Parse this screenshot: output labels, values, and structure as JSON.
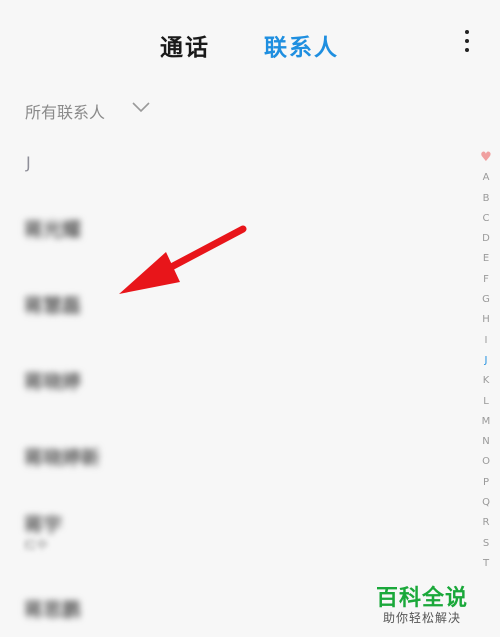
{
  "header": {
    "tab_calls": "通话",
    "tab_contacts": "联系人",
    "more_icon": "more-vertical-icon"
  },
  "filter": {
    "label": "所有联系人",
    "icon": "chevron-down-icon"
  },
  "section": {
    "letter": "J"
  },
  "contacts": [
    {
      "name": "蒋光耀",
      "sub": ""
    },
    {
      "name": "蒋慧磊",
      "sub": ""
    },
    {
      "name": "蒋晓婷",
      "sub": ""
    },
    {
      "name": "蒋晓婷新",
      "sub": ""
    },
    {
      "name": "蒋宇",
      "sub": "红中"
    },
    {
      "name": "蒋思鹏",
      "sub": ""
    }
  ],
  "index": {
    "heart_icon": "heart-icon",
    "letters": [
      "A",
      "B",
      "C",
      "D",
      "E",
      "F",
      "G",
      "H",
      "I",
      "J",
      "K",
      "L",
      "M",
      "N",
      "O",
      "P",
      "Q",
      "R",
      "S",
      "T"
    ],
    "active": "J",
    "active_color": "#1f8fe0"
  },
  "annotation": {
    "arrow_color": "#e8151a"
  },
  "watermark": {
    "title": "百科全说",
    "subtitle": "助你轻松解决"
  },
  "colors": {
    "accent": "#1f8fe0",
    "watermark": "#1aa83a"
  }
}
